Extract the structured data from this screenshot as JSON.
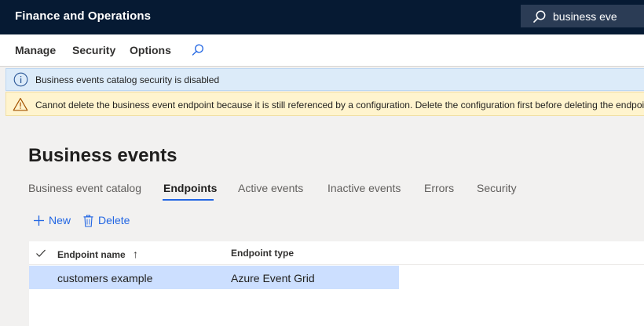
{
  "app": {
    "title": "Finance and Operations"
  },
  "search": {
    "value": "business eve"
  },
  "actionpane": {
    "items": [
      "Manage",
      "Security",
      "Options"
    ]
  },
  "messages": {
    "info": "Business events catalog security is disabled",
    "warning": "Cannot delete the business event endpoint because it is still referenced by a configuration. Delete the configuration first before deleting the endpoint."
  },
  "page": {
    "title": "Business events",
    "tabs": [
      "Business event catalog",
      "Endpoints",
      "Active events",
      "Inactive events",
      "Errors",
      "Security"
    ],
    "active_tab": "Endpoints"
  },
  "toolbar": {
    "new_label": "New",
    "delete_label": "Delete"
  },
  "grid": {
    "columns": [
      "Endpoint name",
      "Endpoint type"
    ],
    "sort_indicator": "↑",
    "rows": [
      {
        "name": "customers example",
        "type": "Azure Event Grid"
      }
    ]
  },
  "colors": {
    "topbar": "#061a33",
    "accent": "#2266e3",
    "info_bg": "#dcebf9",
    "warning_bg": "#fff4ce",
    "selected_row": "#ccdfff"
  }
}
